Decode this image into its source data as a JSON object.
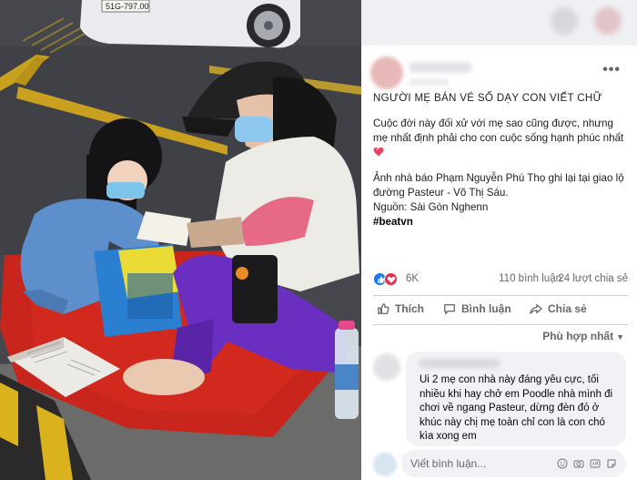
{
  "car_plate": "51G-797.00",
  "post": {
    "title": "NGƯỜI MẸ BÁN VÉ SỐ DẠY CON VIẾT CHỮ",
    "paragraph1": "Cuộc đời này đối xử với mẹ sao cũng được, nhưng mẹ nhất định phải cho con cuộc sống hạnh phúc nhất",
    "paragraph2": "Ảnh nhà báo Phạm Nguyễn Phú Thọ ghi lại tại giao lộ đường Pasteur - Võ Thị Sáu.",
    "source": "Nguồn: Sài Gòn Nghenn",
    "hashtag": "#beatvn"
  },
  "stats": {
    "reactions": "6K",
    "comments": "110 bình luận",
    "shares": "24 lượt chia sẻ"
  },
  "actions": {
    "like": "Thích",
    "comment": "Bình luận",
    "share": "Chia sẻ"
  },
  "sort_label": "Phù hợp nhất",
  "comment": {
    "text": "Ui 2 mẹ con nhà này đáng yêu cực, tối nhiều khi hay chở em Poodle nhà mình đi chơi về ngang Pasteur, dừng đèn đỏ ở khúc này chị mẹ toàn chỉ con là con chó kìa xong em"
  },
  "comment_input": {
    "placeholder": "Viết bình luận..."
  },
  "icons": [
    "more-icon",
    "like-reaction-icon",
    "love-reaction-icon",
    "like-icon",
    "comment-icon",
    "share-icon",
    "emoji-icon",
    "camera-icon",
    "gif-icon",
    "sticker-icon"
  ],
  "colors": {
    "facebook_blue": "#1877f2",
    "love_red": "#f02849",
    "muted_text": "#65676b",
    "comment_bg": "#f0f2f5"
  }
}
